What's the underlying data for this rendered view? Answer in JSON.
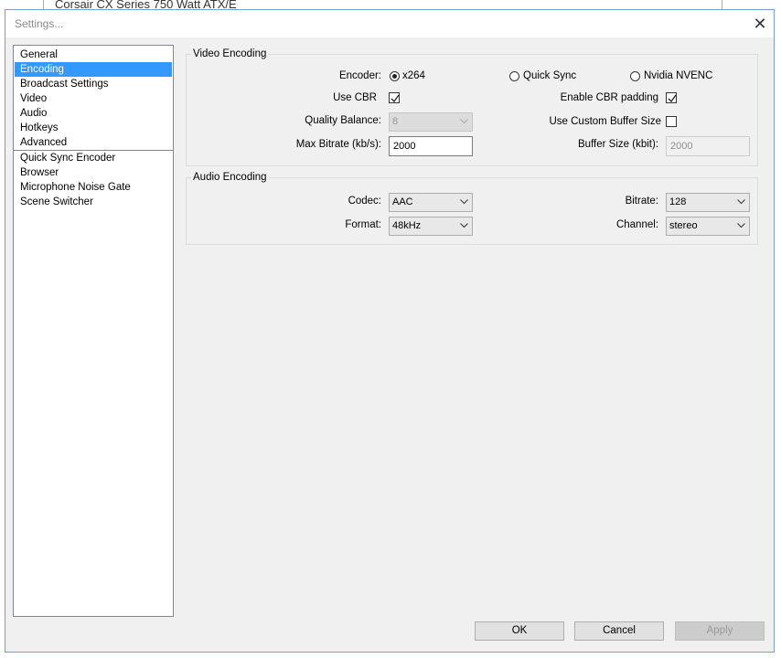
{
  "background_window": {
    "title": "Corsair CX Series 750 Watt ATX/E"
  },
  "dialog": {
    "title": "Settings...",
    "close_glyph": "✕"
  },
  "sidebar": {
    "items": [
      {
        "label": "General"
      },
      {
        "label": "Encoding",
        "selected": true
      },
      {
        "label": "Broadcast Settings"
      },
      {
        "label": "Video"
      },
      {
        "label": "Audio"
      },
      {
        "label": "Hotkeys"
      },
      {
        "label": "Advanced"
      },
      {
        "label": "Quick Sync Encoder"
      },
      {
        "label": "Browser"
      },
      {
        "label": "Microphone Noise Gate"
      },
      {
        "label": "Scene Switcher"
      }
    ]
  },
  "video_encoding": {
    "group_label": "Video Encoding",
    "encoder": {
      "label": "Encoder:",
      "options": [
        {
          "label": "x264",
          "selected": true
        },
        {
          "label": "Quick Sync",
          "selected": false
        },
        {
          "label": "Nvidia NVENC",
          "selected": false
        }
      ]
    },
    "use_cbr": {
      "label": "Use CBR",
      "checked": true
    },
    "enable_cbr_padding": {
      "label": "Enable CBR padding",
      "checked": true
    },
    "quality_balance": {
      "label": "Quality Balance:",
      "value": "8",
      "enabled": false
    },
    "use_custom_buffer": {
      "label": "Use Custom Buffer Size",
      "checked": false
    },
    "max_bitrate": {
      "label": "Max Bitrate (kb/s):",
      "value": "2000"
    },
    "buffer_size": {
      "label": "Buffer Size (kbit):",
      "value": "2000",
      "enabled": false
    }
  },
  "audio_encoding": {
    "group_label": "Audio Encoding",
    "codec": {
      "label": "Codec:",
      "value": "AAC"
    },
    "bitrate": {
      "label": "Bitrate:",
      "value": "128"
    },
    "format": {
      "label": "Format:",
      "value": "48kHz"
    },
    "channel": {
      "label": "Channel:",
      "value": "stereo"
    }
  },
  "buttons": {
    "ok": "OK",
    "cancel": "Cancel",
    "apply": "Apply",
    "apply_enabled": false
  }
}
